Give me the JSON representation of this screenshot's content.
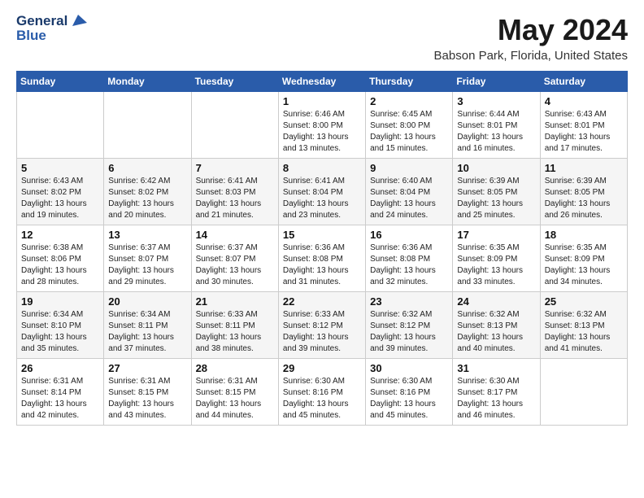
{
  "header": {
    "logo_line1": "General",
    "logo_line2": "Blue",
    "title": "May 2024",
    "subtitle": "Babson Park, Florida, United States"
  },
  "weekdays": [
    "Sunday",
    "Monday",
    "Tuesday",
    "Wednesday",
    "Thursday",
    "Friday",
    "Saturday"
  ],
  "weeks": [
    [
      {
        "day": "",
        "sunrise": "",
        "sunset": "",
        "daylight": ""
      },
      {
        "day": "",
        "sunrise": "",
        "sunset": "",
        "daylight": ""
      },
      {
        "day": "",
        "sunrise": "",
        "sunset": "",
        "daylight": ""
      },
      {
        "day": "1",
        "sunrise": "Sunrise: 6:46 AM",
        "sunset": "Sunset: 8:00 PM",
        "daylight": "Daylight: 13 hours and 13 minutes."
      },
      {
        "day": "2",
        "sunrise": "Sunrise: 6:45 AM",
        "sunset": "Sunset: 8:00 PM",
        "daylight": "Daylight: 13 hours and 15 minutes."
      },
      {
        "day": "3",
        "sunrise": "Sunrise: 6:44 AM",
        "sunset": "Sunset: 8:01 PM",
        "daylight": "Daylight: 13 hours and 16 minutes."
      },
      {
        "day": "4",
        "sunrise": "Sunrise: 6:43 AM",
        "sunset": "Sunset: 8:01 PM",
        "daylight": "Daylight: 13 hours and 17 minutes."
      }
    ],
    [
      {
        "day": "5",
        "sunrise": "Sunrise: 6:43 AM",
        "sunset": "Sunset: 8:02 PM",
        "daylight": "Daylight: 13 hours and 19 minutes."
      },
      {
        "day": "6",
        "sunrise": "Sunrise: 6:42 AM",
        "sunset": "Sunset: 8:02 PM",
        "daylight": "Daylight: 13 hours and 20 minutes."
      },
      {
        "day": "7",
        "sunrise": "Sunrise: 6:41 AM",
        "sunset": "Sunset: 8:03 PM",
        "daylight": "Daylight: 13 hours and 21 minutes."
      },
      {
        "day": "8",
        "sunrise": "Sunrise: 6:41 AM",
        "sunset": "Sunset: 8:04 PM",
        "daylight": "Daylight: 13 hours and 23 minutes."
      },
      {
        "day": "9",
        "sunrise": "Sunrise: 6:40 AM",
        "sunset": "Sunset: 8:04 PM",
        "daylight": "Daylight: 13 hours and 24 minutes."
      },
      {
        "day": "10",
        "sunrise": "Sunrise: 6:39 AM",
        "sunset": "Sunset: 8:05 PM",
        "daylight": "Daylight: 13 hours and 25 minutes."
      },
      {
        "day": "11",
        "sunrise": "Sunrise: 6:39 AM",
        "sunset": "Sunset: 8:05 PM",
        "daylight": "Daylight: 13 hours and 26 minutes."
      }
    ],
    [
      {
        "day": "12",
        "sunrise": "Sunrise: 6:38 AM",
        "sunset": "Sunset: 8:06 PM",
        "daylight": "Daylight: 13 hours and 28 minutes."
      },
      {
        "day": "13",
        "sunrise": "Sunrise: 6:37 AM",
        "sunset": "Sunset: 8:07 PM",
        "daylight": "Daylight: 13 hours and 29 minutes."
      },
      {
        "day": "14",
        "sunrise": "Sunrise: 6:37 AM",
        "sunset": "Sunset: 8:07 PM",
        "daylight": "Daylight: 13 hours and 30 minutes."
      },
      {
        "day": "15",
        "sunrise": "Sunrise: 6:36 AM",
        "sunset": "Sunset: 8:08 PM",
        "daylight": "Daylight: 13 hours and 31 minutes."
      },
      {
        "day": "16",
        "sunrise": "Sunrise: 6:36 AM",
        "sunset": "Sunset: 8:08 PM",
        "daylight": "Daylight: 13 hours and 32 minutes."
      },
      {
        "day": "17",
        "sunrise": "Sunrise: 6:35 AM",
        "sunset": "Sunset: 8:09 PM",
        "daylight": "Daylight: 13 hours and 33 minutes."
      },
      {
        "day": "18",
        "sunrise": "Sunrise: 6:35 AM",
        "sunset": "Sunset: 8:09 PM",
        "daylight": "Daylight: 13 hours and 34 minutes."
      }
    ],
    [
      {
        "day": "19",
        "sunrise": "Sunrise: 6:34 AM",
        "sunset": "Sunset: 8:10 PM",
        "daylight": "Daylight: 13 hours and 35 minutes."
      },
      {
        "day": "20",
        "sunrise": "Sunrise: 6:34 AM",
        "sunset": "Sunset: 8:11 PM",
        "daylight": "Daylight: 13 hours and 37 minutes."
      },
      {
        "day": "21",
        "sunrise": "Sunrise: 6:33 AM",
        "sunset": "Sunset: 8:11 PM",
        "daylight": "Daylight: 13 hours and 38 minutes."
      },
      {
        "day": "22",
        "sunrise": "Sunrise: 6:33 AM",
        "sunset": "Sunset: 8:12 PM",
        "daylight": "Daylight: 13 hours and 39 minutes."
      },
      {
        "day": "23",
        "sunrise": "Sunrise: 6:32 AM",
        "sunset": "Sunset: 8:12 PM",
        "daylight": "Daylight: 13 hours and 39 minutes."
      },
      {
        "day": "24",
        "sunrise": "Sunrise: 6:32 AM",
        "sunset": "Sunset: 8:13 PM",
        "daylight": "Daylight: 13 hours and 40 minutes."
      },
      {
        "day": "25",
        "sunrise": "Sunrise: 6:32 AM",
        "sunset": "Sunset: 8:13 PM",
        "daylight": "Daylight: 13 hours and 41 minutes."
      }
    ],
    [
      {
        "day": "26",
        "sunrise": "Sunrise: 6:31 AM",
        "sunset": "Sunset: 8:14 PM",
        "daylight": "Daylight: 13 hours and 42 minutes."
      },
      {
        "day": "27",
        "sunrise": "Sunrise: 6:31 AM",
        "sunset": "Sunset: 8:15 PM",
        "daylight": "Daylight: 13 hours and 43 minutes."
      },
      {
        "day": "28",
        "sunrise": "Sunrise: 6:31 AM",
        "sunset": "Sunset: 8:15 PM",
        "daylight": "Daylight: 13 hours and 44 minutes."
      },
      {
        "day": "29",
        "sunrise": "Sunrise: 6:30 AM",
        "sunset": "Sunset: 8:16 PM",
        "daylight": "Daylight: 13 hours and 45 minutes."
      },
      {
        "day": "30",
        "sunrise": "Sunrise: 6:30 AM",
        "sunset": "Sunset: 8:16 PM",
        "daylight": "Daylight: 13 hours and 45 minutes."
      },
      {
        "day": "31",
        "sunrise": "Sunrise: 6:30 AM",
        "sunset": "Sunset: 8:17 PM",
        "daylight": "Daylight: 13 hours and 46 minutes."
      },
      {
        "day": "",
        "sunrise": "",
        "sunset": "",
        "daylight": ""
      }
    ]
  ]
}
